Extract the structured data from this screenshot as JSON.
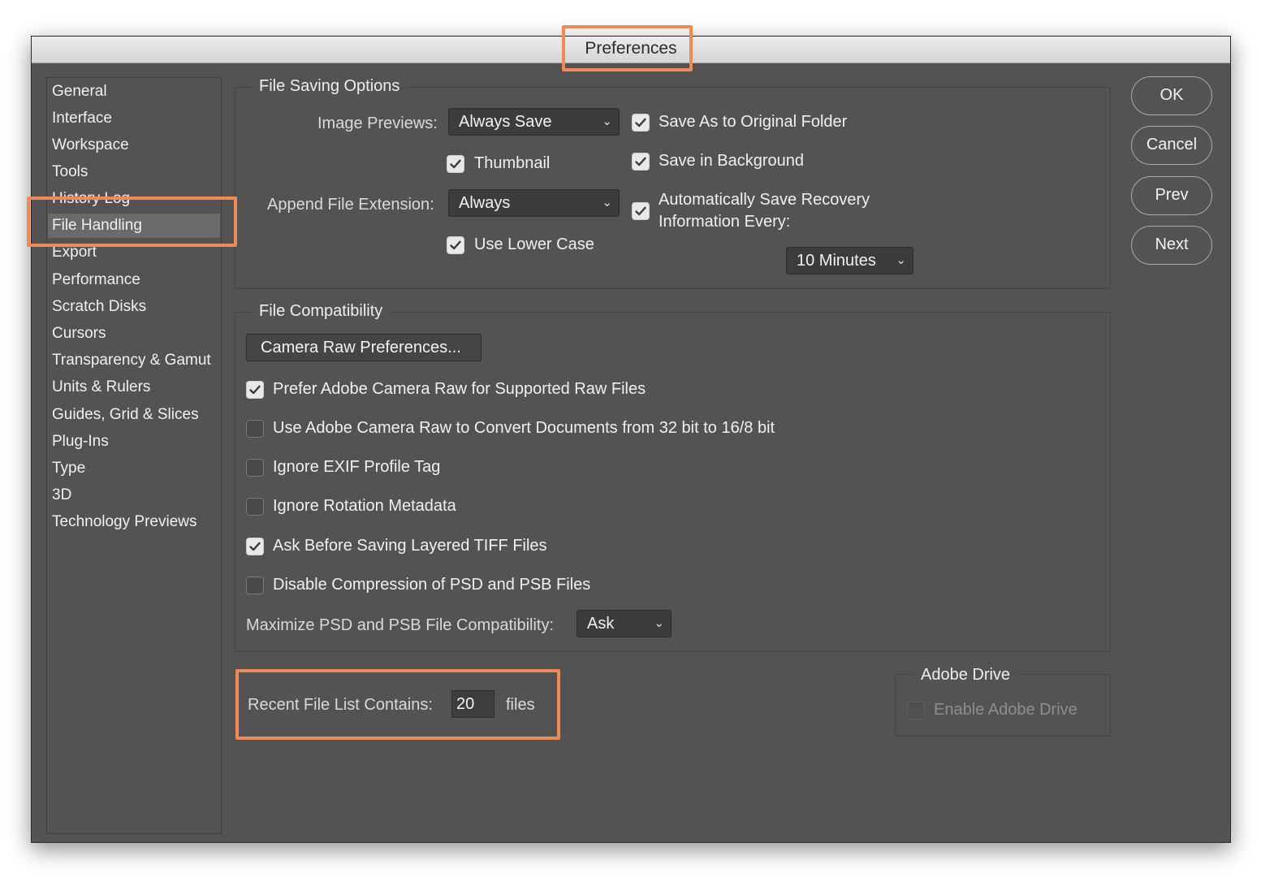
{
  "window": {
    "title": "Preferences"
  },
  "sidebar": {
    "items": [
      {
        "label": "General"
      },
      {
        "label": "Interface"
      },
      {
        "label": "Workspace"
      },
      {
        "label": "Tools"
      },
      {
        "label": "History Log"
      },
      {
        "label": "File Handling",
        "selected": true
      },
      {
        "label": "Export"
      },
      {
        "label": "Performance"
      },
      {
        "label": "Scratch Disks"
      },
      {
        "label": "Cursors"
      },
      {
        "label": "Transparency & Gamut"
      },
      {
        "label": "Units & Rulers"
      },
      {
        "label": "Guides, Grid & Slices"
      },
      {
        "label": "Plug-Ins"
      },
      {
        "label": "Type"
      },
      {
        "label": "3D"
      },
      {
        "label": "Technology Previews"
      }
    ]
  },
  "file_saving": {
    "title": "File Saving Options",
    "image_previews_label": "Image Previews:",
    "image_previews_value": "Always Save",
    "thumbnail_label": "Thumbnail",
    "thumbnail_checked": true,
    "append_ext_label": "Append File Extension:",
    "append_ext_value": "Always",
    "lower_case_label": "Use Lower Case",
    "lower_case_checked": true,
    "save_original_label": "Save As to Original Folder",
    "save_original_checked": true,
    "save_background_label": "Save in Background",
    "save_background_checked": true,
    "auto_save_label_1": "Automatically Save Recovery",
    "auto_save_label_2": "Information Every:",
    "auto_save_checked": true,
    "interval_value": "10 Minutes"
  },
  "compat": {
    "title": "File Compatibility",
    "camera_raw_button": "Camera Raw Preferences...",
    "options": [
      {
        "label": "Prefer Adobe Camera Raw for Supported Raw Files",
        "checked": true
      },
      {
        "label": "Use Adobe Camera Raw to Convert Documents from 32 bit to 16/8 bit",
        "checked": false
      },
      {
        "label": "Ignore EXIF Profile Tag",
        "checked": false
      },
      {
        "label": "Ignore Rotation Metadata",
        "checked": false
      },
      {
        "label": "Ask Before Saving Layered TIFF Files",
        "checked": true
      },
      {
        "label": "Disable Compression of PSD and PSB Files",
        "checked": false
      }
    ],
    "maximize_label": "Maximize PSD and PSB File Compatibility:",
    "maximize_value": "Ask"
  },
  "recent": {
    "label": "Recent File List Contains:",
    "value": "20",
    "suffix": "files"
  },
  "adobe_drive": {
    "title": "Adobe Drive",
    "enable_label": "Enable Adobe Drive",
    "enabled": false
  },
  "buttons": {
    "ok": "OK",
    "cancel": "Cancel",
    "prev": "Prev",
    "next": "Next"
  },
  "colors": {
    "highlight": "#ef8a55",
    "panel": "#535353"
  }
}
